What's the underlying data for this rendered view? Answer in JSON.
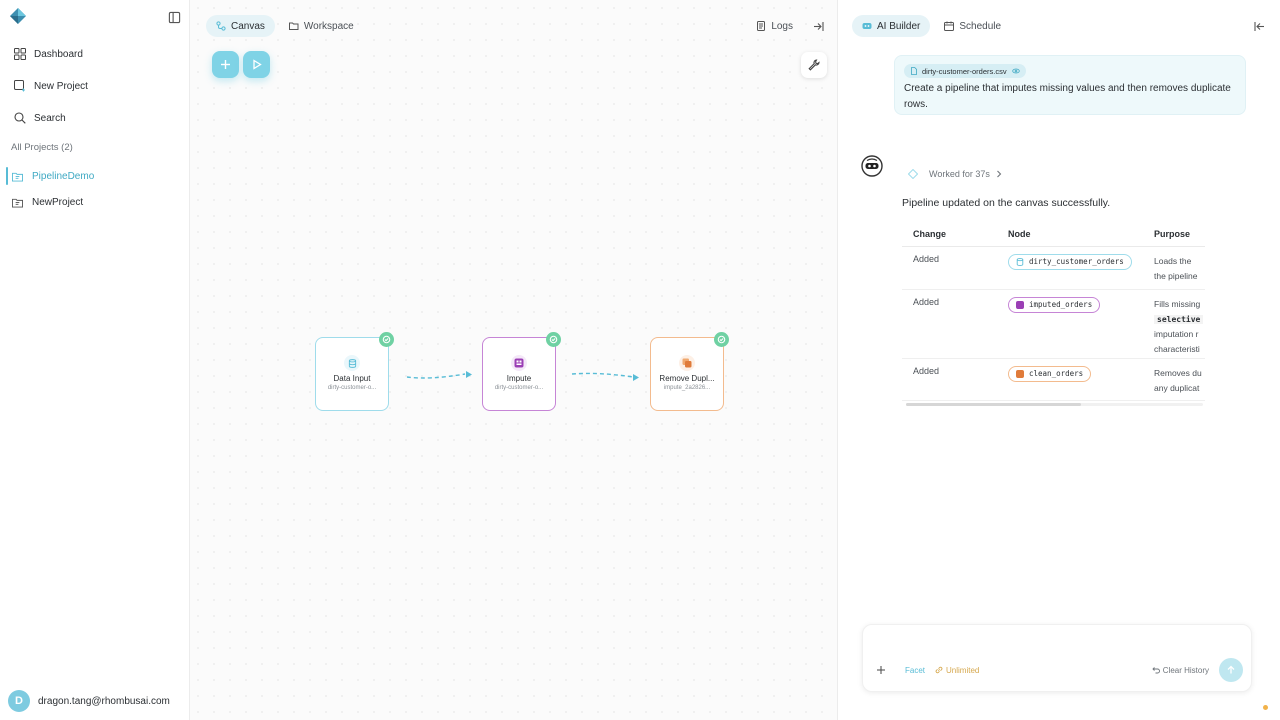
{
  "sidebar": {
    "nav": [
      {
        "label": "Dashboard",
        "icon": "dashboard-icon"
      },
      {
        "label": "New Project",
        "icon": "new-project-icon"
      },
      {
        "label": "Search",
        "icon": "search-icon"
      }
    ],
    "projects_label": "All Projects (2)",
    "projects": [
      {
        "label": "PipelineDemo",
        "active": true
      },
      {
        "label": "NewProject",
        "active": false
      }
    ],
    "user": {
      "initial": "D",
      "email": "dragon.tang@rhombusai.com"
    }
  },
  "canvas": {
    "tabs": [
      {
        "label": "Canvas",
        "active": true
      },
      {
        "label": "Workspace",
        "active": false
      }
    ],
    "logs_label": "Logs",
    "nodes": [
      {
        "title": "Data Input",
        "subtitle": "dirty-customer-o...",
        "color": "#7fd3e6"
      },
      {
        "title": "Impute",
        "subtitle": "dirty-customer-o...",
        "color": "#b463c9"
      },
      {
        "title": "Remove Dupl...",
        "subtitle": "impute_2a2826...",
        "color": "#f0a86e"
      }
    ]
  },
  "ai": {
    "tabs": [
      {
        "label": "AI Builder",
        "active": true
      },
      {
        "label": "Schedule",
        "active": false
      }
    ],
    "attachment": "dirty-customer-orders.csv",
    "prompt": "Create a pipeline that imputes missing values and then removes duplicate rows.",
    "worked": "Worked for 37s",
    "status": "Pipeline updated on the canvas successfully.",
    "table": {
      "headers": [
        "Change",
        "Node",
        "Purpose"
      ],
      "rows": [
        {
          "change": "Added",
          "node": "dirty_customer_orders",
          "purpose_1": "Loads the",
          "purpose_2": "the pipeline"
        },
        {
          "change": "Added",
          "node": "imputed_orders",
          "purpose_1": "Fills missing",
          "purpose_code": "selective",
          "purpose_2": "imputation r",
          "purpose_3": "characteristi"
        },
        {
          "change": "Added",
          "node": "clean_orders",
          "purpose_1": "Removes du",
          "purpose_2": "any duplicat"
        }
      ]
    },
    "chat": {
      "placeholder": "",
      "facet": "Facet",
      "unlimited": "Unlimited",
      "clear_history": "Clear History"
    }
  },
  "colors": {
    "accent": "#58bcd6",
    "success": "#6fd1a3",
    "impute": "#b463c9",
    "dedupe": "#f0a86e"
  }
}
